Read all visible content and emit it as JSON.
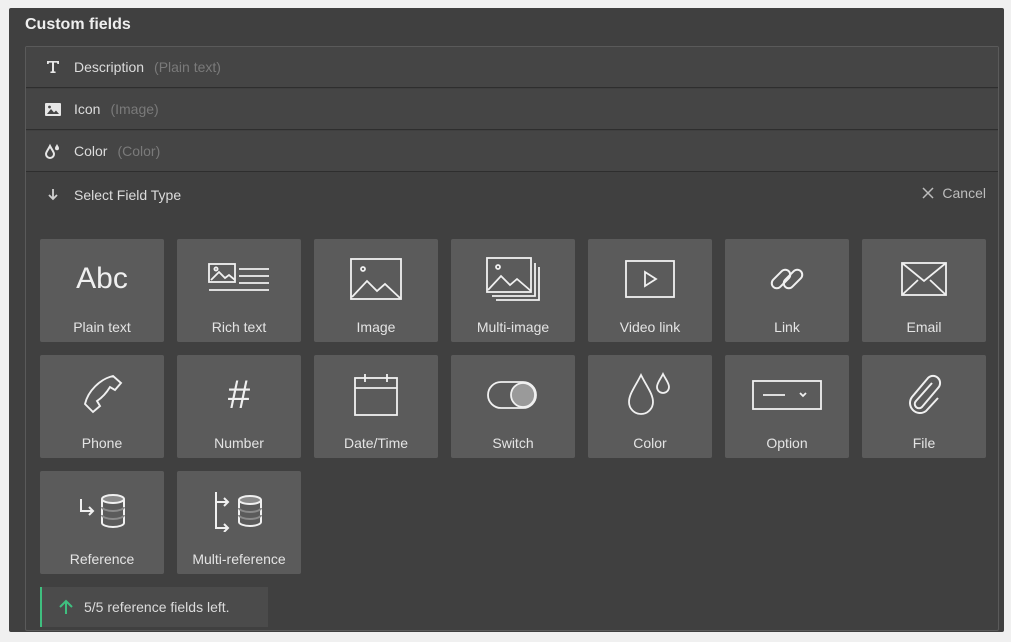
{
  "panel": {
    "title": "Custom fields"
  },
  "fields": [
    {
      "name": "Description",
      "type": "(Plain text)",
      "icon": "text-icon"
    },
    {
      "name": "Icon",
      "type": "(Image)",
      "icon": "image-icon"
    },
    {
      "name": "Color",
      "type": "(Color)",
      "icon": "color-drops-icon"
    }
  ],
  "selector": {
    "label": "Select Field Type",
    "cancel": "Cancel"
  },
  "field_types": [
    {
      "label": "Plain text",
      "icon": "abc-icon"
    },
    {
      "label": "Rich text",
      "icon": "rich-text-icon"
    },
    {
      "label": "Image",
      "icon": "image-icon"
    },
    {
      "label": "Multi-image",
      "icon": "multi-image-icon"
    },
    {
      "label": "Video link",
      "icon": "video-icon"
    },
    {
      "label": "Link",
      "icon": "link-icon"
    },
    {
      "label": "Email",
      "icon": "email-icon"
    },
    {
      "label": "Phone",
      "icon": "phone-icon"
    },
    {
      "label": "Number",
      "icon": "hash-icon"
    },
    {
      "label": "Date/Time",
      "icon": "calendar-icon"
    },
    {
      "label": "Switch",
      "icon": "switch-icon"
    },
    {
      "label": "Color",
      "icon": "color-icon"
    },
    {
      "label": "Option",
      "icon": "option-icon"
    },
    {
      "label": "File",
      "icon": "paperclip-icon"
    },
    {
      "label": "Reference",
      "icon": "reference-icon"
    },
    {
      "label": "Multi-reference",
      "icon": "multi-reference-icon"
    }
  ],
  "tile_icon_text": {
    "abc": "Abc",
    "hash": "#"
  },
  "notice": {
    "text": "5/5 reference fields left.",
    "accent": "#3fbf7f"
  }
}
